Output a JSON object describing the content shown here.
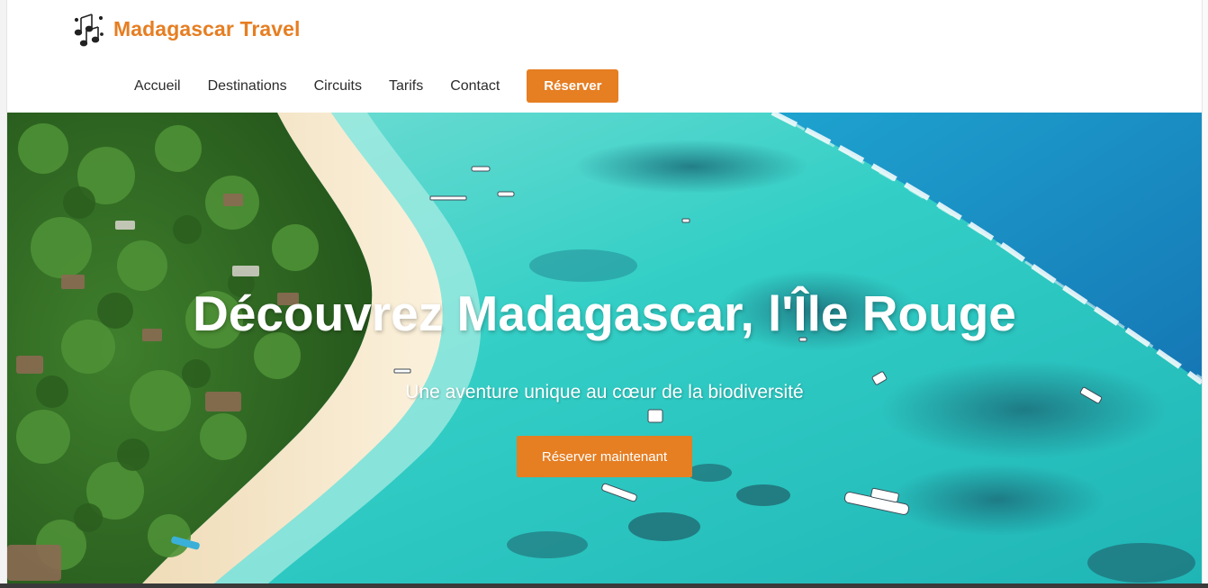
{
  "brand": {
    "name": "Madagascar Travel",
    "icon": "music-notes-icon",
    "color": "#e67e22"
  },
  "nav": {
    "links": [
      "Accueil",
      "Destinations",
      "Circuits",
      "Tarifs",
      "Contact"
    ],
    "cta": "Réserver"
  },
  "hero": {
    "title": "Découvrez Madagascar, l'Île Rouge",
    "subtitle": "Une aventure unique au cœur de la biodiversité",
    "cta": "Réserver maintenant",
    "image": "aerial-beach-lagoon-photo"
  },
  "colors": {
    "accent": "#e67e22",
    "nav_text": "#2c2c2c",
    "lagoon": "#2fc9c4",
    "ocean": "#1e8fc8",
    "sand": "#f3e3c3",
    "forest": "#2e6a24"
  }
}
